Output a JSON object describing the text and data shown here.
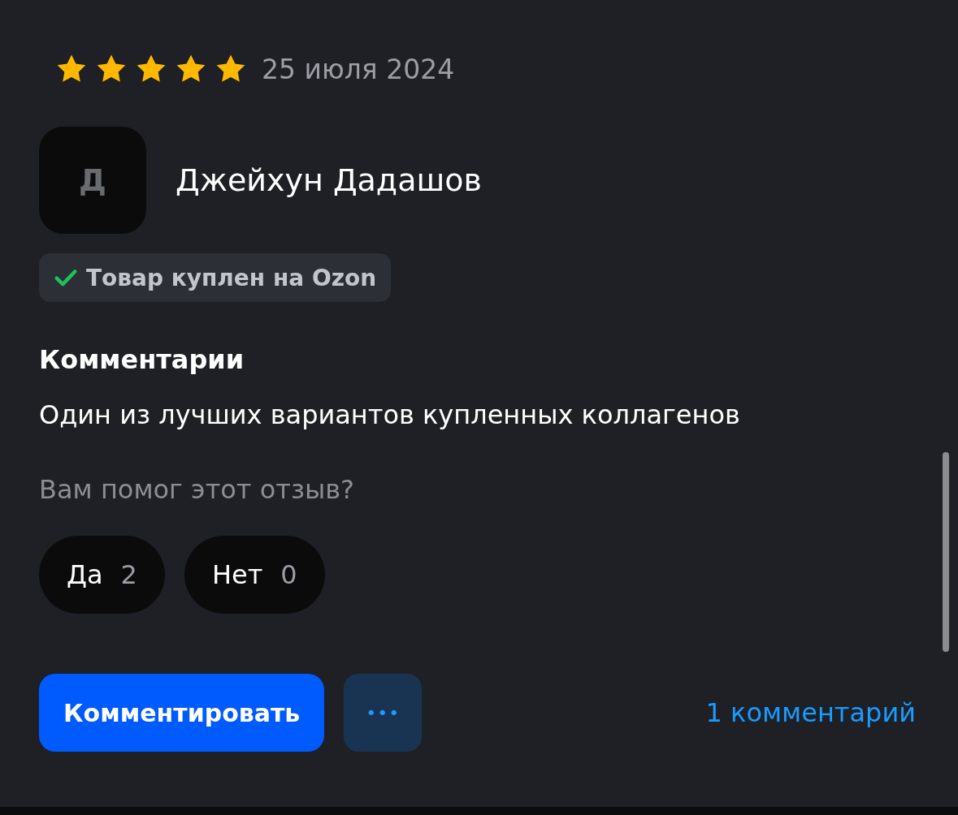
{
  "review": {
    "stars": 5,
    "date": "25 июля 2024",
    "avatar_letter": "Д",
    "author": "Джейхун Дадашов",
    "badge": "Товар куплен на Ozon",
    "section_title": "Комментарии",
    "text": "Один из лучших вариантов купленных коллагенов",
    "helpful_question": "Вам помог этот отзыв?"
  },
  "votes": [
    {
      "label": "Да",
      "count": "2"
    },
    {
      "label": "Нет",
      "count": "0"
    }
  ],
  "actions": {
    "comment_button": "Комментировать",
    "more_button": "•••",
    "comments_link": "1 комментарий"
  }
}
